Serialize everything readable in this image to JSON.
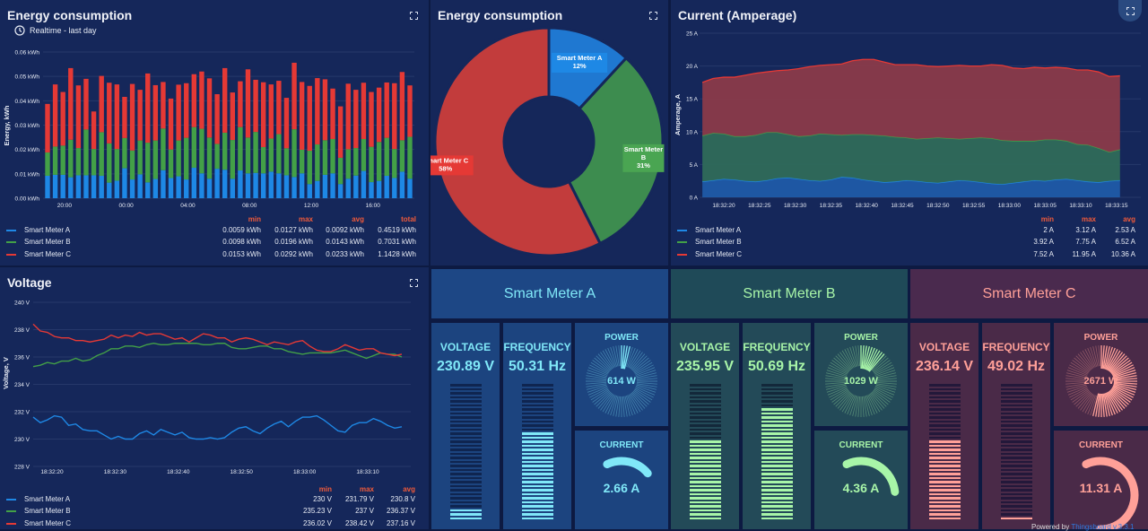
{
  "colors": {
    "meter_a": "#1e88e5",
    "meter_b": "#43a047",
    "meter_c": "#e53935",
    "accent_a": "#80e8f8",
    "accent_b": "#a8f5a8",
    "accent_c": "#ffa098",
    "legend_header": "#f05a3a"
  },
  "top_right_button": {
    "icon": "fullscreen-exit-icon"
  },
  "energy_bar": {
    "title": "Energy consumption",
    "subtitle": "Realtime - last day",
    "icon": "clock-icon",
    "chart_data": {
      "type": "bar",
      "stacked": true,
      "ylabel": "Energy, kWh",
      "ylim": [
        0,
        0.06
      ],
      "yticks": [
        "0.00 kWh",
        "0.01 kWh",
        "0.02 kWh",
        "0.03 kWh",
        "0.04 kWh",
        "0.05 kWh",
        "0.06 kWh"
      ],
      "xticks": [
        "20:00",
        "00:00",
        "04:00",
        "08:00",
        "12:00",
        "16:00"
      ],
      "series": [
        {
          "name": "Smart Meter A",
          "values": [
            0.0092,
            0.0096,
            0.0096,
            0.0086,
            0.0094,
            0.0094,
            0.0094,
            0.0092,
            0.0064,
            0.0072,
            0.0123,
            0.0077,
            0.0098,
            0.0065,
            0.0079,
            0.0115,
            0.0083,
            0.009,
            0.0077,
            0.0125,
            0.0102,
            0.008,
            0.0121,
            0.0117,
            0.008,
            0.0114,
            0.0102,
            0.0104,
            0.0102,
            0.0109,
            0.0102,
            0.0094,
            0.0087,
            0.0102,
            0.0058,
            0.0071,
            0.0096,
            0.0102,
            0.0058,
            0.008,
            0.0093,
            0.0112,
            0.0066,
            0.0071,
            0.0092,
            0.0083,
            0.0109,
            0.008
          ]
        },
        {
          "name": "Smart Meter B",
          "values": [
            0.0096,
            0.0116,
            0.012,
            0.0154,
            0.0112,
            0.0188,
            0.0108,
            0.0179,
            0.0161,
            0.013,
            0.0124,
            0.0119,
            0.0139,
            0.0163,
            0.0158,
            0.0171,
            0.0117,
            0.0147,
            0.0171,
            0.0167,
            0.0183,
            0.0169,
            0.0102,
            0.0152,
            0.0159,
            0.0178,
            0.0147,
            0.0168,
            0.0108,
            0.0136,
            0.0161,
            0.0111,
            0.0196,
            0.0097,
            0.0137,
            0.015,
            0.0142,
            0.0141,
            0.0108,
            0.0121,
            0.0113,
            0.0131,
            0.0145,
            0.016,
            0.0156,
            0.0119,
            0.0129,
            0.0172
          ]
        },
        {
          "name": "Smart Meter C",
          "values": [
            0.0199,
            0.0255,
            0.022,
            0.0294,
            0.0257,
            0.0208,
            0.0154,
            0.0231,
            0.0249,
            0.0265,
            0.0169,
            0.0273,
            0.0208,
            0.0284,
            0.0227,
            0.0191,
            0.0209,
            0.0229,
            0.0224,
            0.0217,
            0.0235,
            0.0243,
            0.0204,
            0.0265,
            0.0195,
            0.0188,
            0.028,
            0.0214,
            0.0266,
            0.0222,
            0.0219,
            0.0207,
            0.0273,
            0.0278,
            0.0266,
            0.0272,
            0.025,
            0.0207,
            0.0211,
            0.0269,
            0.0239,
            0.0231,
            0.0225,
            0.0223,
            0.0227,
            0.027,
            0.028,
            0.0211
          ]
        }
      ]
    },
    "legend": {
      "headers": [
        "min",
        "max",
        "avg",
        "total"
      ],
      "rows": [
        {
          "name": "Smart Meter A",
          "values": [
            "0.0059 kWh",
            "0.0127 kWh",
            "0.0092 kWh",
            "0.4519 kWh"
          ]
        },
        {
          "name": "Smart Meter B",
          "values": [
            "0.0098 kWh",
            "0.0196 kWh",
            "0.0143 kWh",
            "0.7031 kWh"
          ]
        },
        {
          "name": "Smart Meter C",
          "values": [
            "0.0153 kWh",
            "0.0292 kWh",
            "0.0233 kWh",
            "1.1428 kWh"
          ]
        }
      ]
    }
  },
  "energy_pie": {
    "title": "Energy consumption",
    "chart_data": {
      "type": "pie",
      "donut": true,
      "slices": [
        {
          "name": "Smart Meter A",
          "value": 12,
          "label": "12%"
        },
        {
          "name": "Smart Meter B",
          "value": 31,
          "label": "31%"
        },
        {
          "name": "Smart Meter C",
          "value": 58,
          "label": "58%"
        }
      ]
    }
  },
  "current_chart": {
    "title": "Current (Amperage)",
    "chart_data": {
      "type": "area",
      "stacked": true,
      "ylabel": "Amperage, A",
      "ylim": [
        0,
        25
      ],
      "yticks": [
        "0 A",
        "5 A",
        "10 A",
        "15 A",
        "20 A",
        "25 A"
      ],
      "xticks": [
        "18:32:20",
        "18:32:25",
        "18:32:30",
        "18:32:35",
        "18:32:40",
        "18:32:45",
        "18:32:50",
        "18:32:55",
        "18:33:00",
        "18:33:05",
        "18:33:10",
        "18:33:15"
      ],
      "series": [
        {
          "name": "Smart Meter A",
          "values": [
            2.4,
            2.6,
            2.8,
            2.7,
            2.5,
            2.4,
            2.6,
            2.9,
            3.0,
            2.8,
            2.6,
            2.5,
            2.7,
            3.1,
            3.0,
            2.7,
            2.5,
            2.3,
            2.4,
            2.6,
            2.5,
            2.3,
            2.2,
            2.4,
            2.6,
            2.5,
            2.3,
            2.1,
            2.0,
            2.2,
            2.4,
            2.6,
            2.5,
            2.7,
            2.8,
            2.6,
            2.4,
            2.3,
            2.5,
            2.6
          ]
        },
        {
          "name": "Smart Meter B",
          "values": [
            7.0,
            7.2,
            6.9,
            6.6,
            6.8,
            7.1,
            7.3,
            7.0,
            6.6,
            6.5,
            6.8,
            7.2,
            6.9,
            6.4,
            6.6,
            6.9,
            7.0,
            7.1,
            6.8,
            6.5,
            6.4,
            6.7,
            6.9,
            6.6,
            6.3,
            6.5,
            6.8,
            6.9,
            6.7,
            6.4,
            6.2,
            6.0,
            6.3,
            6.1,
            5.8,
            5.5,
            5.6,
            5.2,
            4.4,
            4.7
          ]
        },
        {
          "name": "Smart Meter C",
          "values": [
            8.1,
            8.3,
            8.6,
            9.0,
            9.3,
            9.4,
            9.2,
            9.4,
            9.8,
            10.3,
            10.5,
            10.4,
            10.6,
            10.8,
            11.2,
            11.4,
            11.5,
            11.2,
            11.0,
            11.1,
            11.3,
            11.0,
            10.8,
            11.0,
            11.2,
            11.0,
            10.9,
            11.2,
            11.4,
            11.1,
            11.0,
            11.2,
            10.9,
            11.0,
            11.1,
            11.3,
            11.4,
            11.6,
            11.5,
            11.2
          ]
        }
      ]
    },
    "legend": {
      "headers": [
        "min",
        "max",
        "avg"
      ],
      "rows": [
        {
          "name": "Smart Meter A",
          "values": [
            "2 A",
            "3.12 A",
            "2.53 A"
          ]
        },
        {
          "name": "Smart Meter B",
          "values": [
            "3.92 A",
            "7.75 A",
            "6.52 A"
          ]
        },
        {
          "name": "Smart Meter C",
          "values": [
            "7.52 A",
            "11.95 A",
            "10.36 A"
          ]
        }
      ]
    }
  },
  "voltage_chart": {
    "title": "Voltage",
    "chart_data": {
      "type": "line",
      "ylabel": "Voltage, V",
      "ylim": [
        228,
        240
      ],
      "yticks": [
        "228 V",
        "230 V",
        "232 V",
        "234 V",
        "236 V",
        "238 V",
        "240 V"
      ],
      "xticks": [
        "18:32:20",
        "18:32:30",
        "18:32:40",
        "18:32:50",
        "18:33:00",
        "18:33:10"
      ],
      "series": [
        {
          "name": "Smart Meter A",
          "values": [
            231.6,
            231.2,
            231.4,
            231.7,
            231.6,
            231.0,
            231.1,
            230.7,
            230.6,
            230.6,
            230.3,
            230.0,
            230.2,
            230.0,
            230.0,
            230.4,
            230.6,
            230.3,
            230.7,
            230.5,
            230.3,
            230.5,
            230.1,
            230.0,
            230.0,
            230.1,
            230.0,
            230.1,
            230.5,
            230.8,
            230.9,
            230.6,
            230.4,
            230.8,
            231.1,
            231.3,
            230.9,
            231.3,
            231.6,
            231.6,
            231.7,
            231.4,
            231.0,
            230.6,
            230.5,
            231.0,
            231.2,
            231.2,
            231.5,
            231.3,
            231.0,
            230.8,
            230.9
          ]
        },
        {
          "name": "Smart Meter B",
          "values": [
            235.3,
            235.4,
            235.6,
            235.5,
            235.7,
            235.7,
            235.9,
            235.7,
            235.8,
            236.1,
            236.3,
            236.6,
            236.6,
            236.8,
            236.8,
            236.7,
            236.9,
            237.0,
            236.9,
            236.9,
            237.0,
            237.0,
            237.0,
            237.0,
            236.9,
            236.9,
            237.0,
            237.0,
            236.7,
            236.6,
            236.6,
            236.7,
            236.8,
            236.8,
            236.6,
            236.6,
            236.4,
            236.3,
            236.2,
            236.3,
            236.3,
            236.3,
            236.3,
            236.4,
            236.5,
            236.3,
            236.1,
            235.9,
            236.1,
            236.3,
            236.2,
            236.2,
            236.0
          ]
        },
        {
          "name": "Smart Meter C",
          "values": [
            238.4,
            237.9,
            237.8,
            237.5,
            237.4,
            237.4,
            237.2,
            237.2,
            237.1,
            237.2,
            237.3,
            237.6,
            237.4,
            237.6,
            237.5,
            237.8,
            237.6,
            237.7,
            237.7,
            237.5,
            237.3,
            237.4,
            237.1,
            237.4,
            237.7,
            237.6,
            237.4,
            237.4,
            237.1,
            237.3,
            237.4,
            237.3,
            237.1,
            236.9,
            237.1,
            237.0,
            236.9,
            237.1,
            237.2,
            236.8,
            236.5,
            236.4,
            236.4,
            236.6,
            236.9,
            236.7,
            236.5,
            236.6,
            236.6,
            236.3,
            236.2,
            236.1,
            236.2
          ]
        }
      ]
    },
    "legend": {
      "headers": [
        "min",
        "max",
        "avg"
      ],
      "rows": [
        {
          "name": "Smart Meter A",
          "values": [
            "230 V",
            "231.79 V",
            "230.8 V"
          ]
        },
        {
          "name": "Smart Meter B",
          "values": [
            "235.23 V",
            "237 V",
            "236.37 V"
          ]
        },
        {
          "name": "Smart Meter C",
          "values": [
            "236.02 V",
            "238.42 V",
            "237.16 V"
          ]
        }
      ]
    }
  },
  "meters": [
    {
      "title": "Smart Meter A",
      "voltage_label": "VOLTAGE",
      "voltage": "230.89 V",
      "voltage_level": 0.1,
      "frequency_label": "FREQUENCY",
      "frequency": "50.31 Hz",
      "frequency_level": 0.65,
      "power_label": "POWER",
      "power": "614 W",
      "power_level": 0.04,
      "current_label": "CURRENT",
      "current": "2.66 A",
      "current_level": 0.22
    },
    {
      "title": "Smart Meter B",
      "voltage_label": "VOLTAGE",
      "voltage": "235.95 V",
      "voltage_level": 0.6,
      "frequency_label": "FREQUENCY",
      "frequency": "50.69 Hz",
      "frequency_level": 0.84,
      "power_label": "POWER",
      "power": "1029 W",
      "power_level": 0.12,
      "current_label": "CURRENT",
      "current": "4.36 A",
      "current_level": 0.32
    },
    {
      "title": "Smart Meter C",
      "voltage_label": "VOLTAGE",
      "voltage": "236.14 V",
      "voltage_level": 0.6,
      "frequency_label": "FREQUENCY",
      "frequency": "49.02 Hz",
      "frequency_level": 0.03,
      "power_label": "POWER",
      "power": "2671 W",
      "power_level": 0.55,
      "current_label": "CURRENT",
      "current": "11.31 A",
      "current_level": 0.6
    }
  ],
  "footer": {
    "powered_by": "Powered by",
    "brand": "Thingsboard v.3.3.1"
  }
}
